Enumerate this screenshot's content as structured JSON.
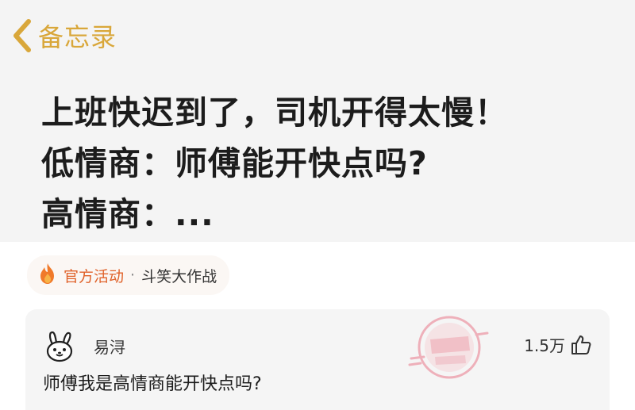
{
  "notes": {
    "back_label": "备忘录"
  },
  "memo": {
    "lines": [
      "上班快迟到了，司机开得太慢！",
      "低情商：师傅能开快点吗?",
      "高情商：..."
    ]
  },
  "event_tag": {
    "primary": "官方活动",
    "separator": "·",
    "secondary": "斗笑大作战"
  },
  "comment": {
    "username": "易浔",
    "like_count": "1.5万",
    "text": "师傅我是高情商能开快点吗?"
  },
  "colors": {
    "accent_gold": "#d9a73a",
    "event_orange": "#e0622a",
    "stamp_pink": "#e9798a"
  },
  "icons": [
    "chevron-left-icon",
    "flame-icon",
    "rabbit-avatar-icon",
    "thumbs-up-icon"
  ]
}
